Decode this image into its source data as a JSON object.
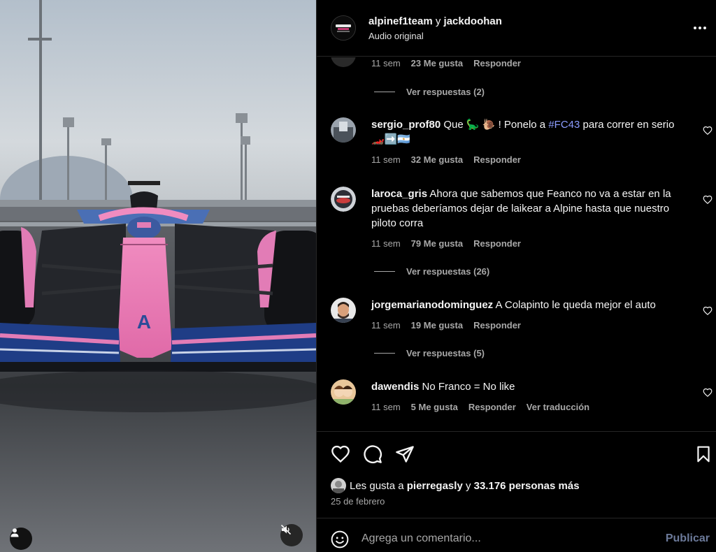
{
  "post": {
    "author_primary": "alpinef1team",
    "connector": "y",
    "author_secondary": "jackdoohan",
    "audio": "Audio original"
  },
  "comments": [
    {
      "partial": true,
      "time": "11 sem",
      "likes": "23 Me gusta",
      "reply": "Responder",
      "view_replies": "Ver respuestas (2)"
    },
    {
      "user": "sergio_prof80",
      "text_before": "Que 🦕 🐌 ! Ponelo a",
      "hashtag": "#FC43",
      "text_after": "para correr en serio 🏎️➡️🇦🇷",
      "time": "11 sem",
      "likes": "32 Me gusta",
      "reply": "Responder"
    },
    {
      "user": "laroca_gris",
      "text": "Ahora que sabemos que Feanco no va a estar en la pruebas deberíamos dejar de laikear a Alpine hasta que nuestro piloto corra",
      "time": "11 sem",
      "likes": "79 Me gusta",
      "reply": "Responder",
      "view_replies": "Ver respuestas (26)"
    },
    {
      "user": "jorgemarianodominguez",
      "text": "A Colapinto le queda mejor el auto",
      "time": "11 sem",
      "likes": "19 Me gusta",
      "reply": "Responder",
      "view_replies": "Ver respuestas (5)"
    },
    {
      "user": "dawendis",
      "text": "No Franco = No like",
      "time": "11 sem",
      "likes": "5 Me gusta",
      "reply": "Responder",
      "translate": "Ver traducción"
    }
  ],
  "likes_summary": {
    "prefix": "Les gusta a",
    "user": "pierregasly",
    "connector": "y",
    "others": "33.176 personas más"
  },
  "date": "25 de febrero",
  "comment_box": {
    "placeholder": "Agrega un comentario...",
    "publish": "Publicar"
  },
  "icons": {
    "like": "heart-icon",
    "comment": "comment-bubble-icon",
    "share": "paper-plane-icon",
    "save": "bookmark-icon",
    "emoji": "smiley-icon",
    "more": "ellipsis-icon",
    "mute": "muted-speaker-icon",
    "tags": "person-icon"
  },
  "colors": {
    "background": "#000000",
    "text": "#f5f5f5",
    "secondary_text": "#a8a8a8",
    "hashtag": "#8c9dff",
    "publish_disabled": "#6c7a9a",
    "divider": "#262626"
  }
}
